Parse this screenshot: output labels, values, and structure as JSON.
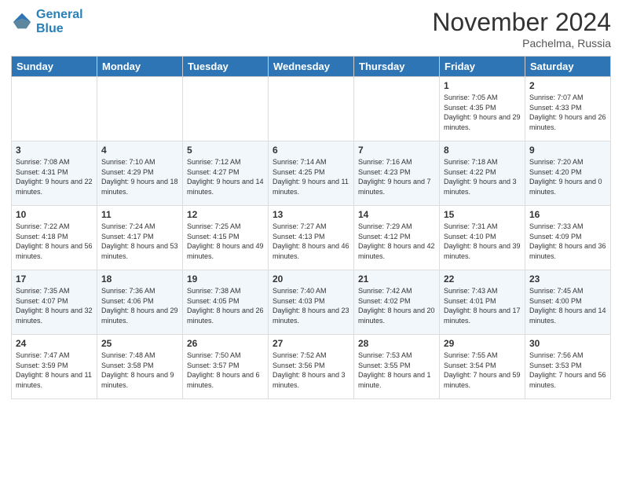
{
  "header": {
    "logo_line1": "General",
    "logo_line2": "Blue",
    "month": "November 2024",
    "location": "Pachelma, Russia"
  },
  "weekdays": [
    "Sunday",
    "Monday",
    "Tuesday",
    "Wednesday",
    "Thursday",
    "Friday",
    "Saturday"
  ],
  "weeks": [
    [
      {
        "day": "",
        "info": ""
      },
      {
        "day": "",
        "info": ""
      },
      {
        "day": "",
        "info": ""
      },
      {
        "day": "",
        "info": ""
      },
      {
        "day": "",
        "info": ""
      },
      {
        "day": "1",
        "info": "Sunrise: 7:05 AM\nSunset: 4:35 PM\nDaylight: 9 hours and 29 minutes."
      },
      {
        "day": "2",
        "info": "Sunrise: 7:07 AM\nSunset: 4:33 PM\nDaylight: 9 hours and 26 minutes."
      }
    ],
    [
      {
        "day": "3",
        "info": "Sunrise: 7:08 AM\nSunset: 4:31 PM\nDaylight: 9 hours and 22 minutes."
      },
      {
        "day": "4",
        "info": "Sunrise: 7:10 AM\nSunset: 4:29 PM\nDaylight: 9 hours and 18 minutes."
      },
      {
        "day": "5",
        "info": "Sunrise: 7:12 AM\nSunset: 4:27 PM\nDaylight: 9 hours and 14 minutes."
      },
      {
        "day": "6",
        "info": "Sunrise: 7:14 AM\nSunset: 4:25 PM\nDaylight: 9 hours and 11 minutes."
      },
      {
        "day": "7",
        "info": "Sunrise: 7:16 AM\nSunset: 4:23 PM\nDaylight: 9 hours and 7 minutes."
      },
      {
        "day": "8",
        "info": "Sunrise: 7:18 AM\nSunset: 4:22 PM\nDaylight: 9 hours and 3 minutes."
      },
      {
        "day": "9",
        "info": "Sunrise: 7:20 AM\nSunset: 4:20 PM\nDaylight: 9 hours and 0 minutes."
      }
    ],
    [
      {
        "day": "10",
        "info": "Sunrise: 7:22 AM\nSunset: 4:18 PM\nDaylight: 8 hours and 56 minutes."
      },
      {
        "day": "11",
        "info": "Sunrise: 7:24 AM\nSunset: 4:17 PM\nDaylight: 8 hours and 53 minutes."
      },
      {
        "day": "12",
        "info": "Sunrise: 7:25 AM\nSunset: 4:15 PM\nDaylight: 8 hours and 49 minutes."
      },
      {
        "day": "13",
        "info": "Sunrise: 7:27 AM\nSunset: 4:13 PM\nDaylight: 8 hours and 46 minutes."
      },
      {
        "day": "14",
        "info": "Sunrise: 7:29 AM\nSunset: 4:12 PM\nDaylight: 8 hours and 42 minutes."
      },
      {
        "day": "15",
        "info": "Sunrise: 7:31 AM\nSunset: 4:10 PM\nDaylight: 8 hours and 39 minutes."
      },
      {
        "day": "16",
        "info": "Sunrise: 7:33 AM\nSunset: 4:09 PM\nDaylight: 8 hours and 36 minutes."
      }
    ],
    [
      {
        "day": "17",
        "info": "Sunrise: 7:35 AM\nSunset: 4:07 PM\nDaylight: 8 hours and 32 minutes."
      },
      {
        "day": "18",
        "info": "Sunrise: 7:36 AM\nSunset: 4:06 PM\nDaylight: 8 hours and 29 minutes."
      },
      {
        "day": "19",
        "info": "Sunrise: 7:38 AM\nSunset: 4:05 PM\nDaylight: 8 hours and 26 minutes."
      },
      {
        "day": "20",
        "info": "Sunrise: 7:40 AM\nSunset: 4:03 PM\nDaylight: 8 hours and 23 minutes."
      },
      {
        "day": "21",
        "info": "Sunrise: 7:42 AM\nSunset: 4:02 PM\nDaylight: 8 hours and 20 minutes."
      },
      {
        "day": "22",
        "info": "Sunrise: 7:43 AM\nSunset: 4:01 PM\nDaylight: 8 hours and 17 minutes."
      },
      {
        "day": "23",
        "info": "Sunrise: 7:45 AM\nSunset: 4:00 PM\nDaylight: 8 hours and 14 minutes."
      }
    ],
    [
      {
        "day": "24",
        "info": "Sunrise: 7:47 AM\nSunset: 3:59 PM\nDaylight: 8 hours and 11 minutes."
      },
      {
        "day": "25",
        "info": "Sunrise: 7:48 AM\nSunset: 3:58 PM\nDaylight: 8 hours and 9 minutes."
      },
      {
        "day": "26",
        "info": "Sunrise: 7:50 AM\nSunset: 3:57 PM\nDaylight: 8 hours and 6 minutes."
      },
      {
        "day": "27",
        "info": "Sunrise: 7:52 AM\nSunset: 3:56 PM\nDaylight: 8 hours and 3 minutes."
      },
      {
        "day": "28",
        "info": "Sunrise: 7:53 AM\nSunset: 3:55 PM\nDaylight: 8 hours and 1 minute."
      },
      {
        "day": "29",
        "info": "Sunrise: 7:55 AM\nSunset: 3:54 PM\nDaylight: 7 hours and 59 minutes."
      },
      {
        "day": "30",
        "info": "Sunrise: 7:56 AM\nSunset: 3:53 PM\nDaylight: 7 hours and 56 minutes."
      }
    ]
  ]
}
